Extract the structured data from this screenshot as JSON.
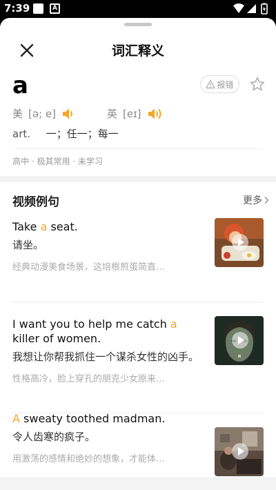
{
  "status": {
    "time": "7:39",
    "notif_letter": "A"
  },
  "header": {
    "title": "词汇释义"
  },
  "word": {
    "text": "a",
    "report_label": "报错",
    "us_label": "美",
    "us_phonetic": "[ə; e]",
    "uk_label": "英",
    "uk_phonetic": "[eɪ]",
    "pos": "art.",
    "definition": "一；任一；每一",
    "tags": "高中 · 极其常用 · 未学习"
  },
  "examples_section": {
    "title": "视频例句",
    "more_label": "更多"
  },
  "examples": [
    {
      "en_pre": "Take ",
      "en_hl": "a",
      "en_post": " seat.",
      "zh": "请坐。",
      "note": "经典动漫美食场景，这培根煎蛋简直…"
    },
    {
      "en_pre": "I want you to help me catch ",
      "en_hl": "a",
      "en_post": " killer of women.",
      "zh": "我想让你帮我抓住一个谋杀女性的凶手。",
      "note": "性格高冷，脸上穿孔的朋克少女原来…"
    },
    {
      "en_pre": "",
      "en_hl": "A",
      "en_post": " sweaty toothed madman.",
      "zh": "令人齿寒的疯子。",
      "note": "用激荡的感情和绝妙的想象，才能体…"
    }
  ],
  "colors": {
    "highlight": "#f5a623",
    "speaker": "#f5a623"
  }
}
